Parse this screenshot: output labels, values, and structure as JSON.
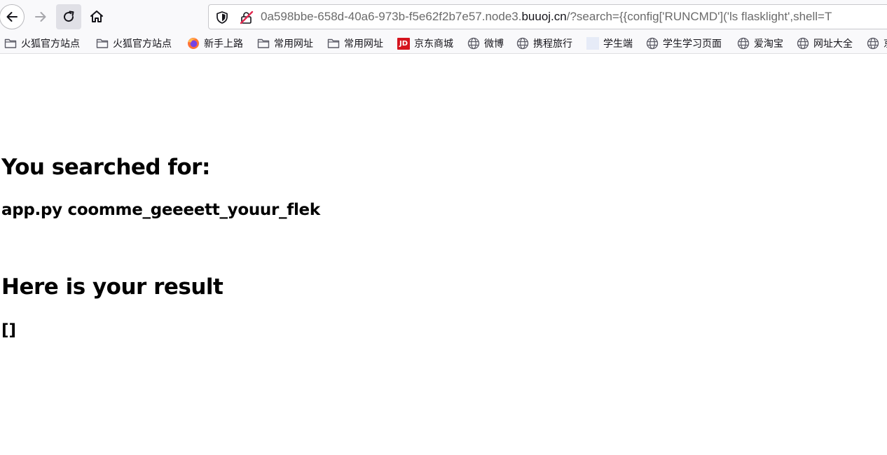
{
  "browser": {
    "toolbar": {
      "back_icon": "arrow-left-icon",
      "forward_icon": "arrow-right-icon",
      "reload_icon": "reload-icon",
      "home_icon": "home-icon"
    },
    "urlbar": {
      "url_prefix": "0a598bbe-658d-40a6-973b-f5e62f2b7e57.node3.",
      "url_host": "buuoj.cn",
      "url_suffix": "/?search={{config['RUNCMD']('ls flasklight',shell=T",
      "shield_icon": "tracking-protection-shield-icon",
      "lock_icon": "insecure-connection-icon",
      "lock_color": "#e22850"
    },
    "bookmarks": [
      {
        "label": "火狐官方站点",
        "icon": "folder-icon"
      },
      {
        "label": "火狐官方站点",
        "icon": "folder-icon"
      },
      {
        "label": "新手上路",
        "icon": "firefox-icon"
      },
      {
        "label": "常用网址",
        "icon": "folder-icon"
      },
      {
        "label": "常用网址",
        "icon": "folder-icon"
      },
      {
        "label": "京东商城",
        "icon": "jd-logo-icon",
        "icon_text": "JD"
      },
      {
        "label": "微博",
        "icon": "globe-icon"
      },
      {
        "label": "携程旅行",
        "icon": "globe-icon"
      },
      {
        "label": "学生端",
        "icon": "blank-page-icon"
      },
      {
        "label": "学生学习页面",
        "icon": "globe-icon"
      },
      {
        "label": "爱淘宝",
        "icon": "globe-icon"
      },
      {
        "label": "网址大全",
        "icon": "globe-icon"
      },
      {
        "label": "京",
        "icon": "globe-icon"
      }
    ]
  },
  "page": {
    "searched_heading": "You searched for:",
    "query_text": "app.py coomme_geeeett_youur_flek",
    "result_heading": "Here is your result",
    "result_value": "[]"
  }
}
